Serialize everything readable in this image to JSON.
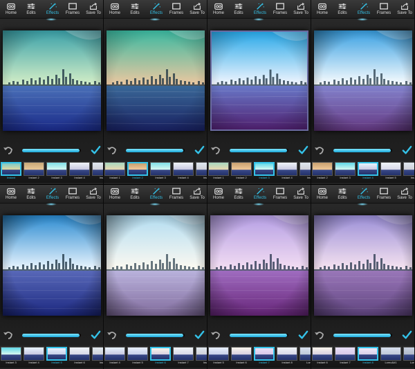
{
  "toolbar": [
    {
      "label": "Home",
      "icon": "home-icon"
    },
    {
      "label": "Edits",
      "icon": "sliders-icon"
    },
    {
      "label": "Effects",
      "icon": "magic-wand-icon"
    },
    {
      "label": "Frames",
      "icon": "frame-icon"
    },
    {
      "label": "Save To",
      "icon": "share-icon"
    }
  ],
  "active_tab": "Effects",
  "accent_color": "#34c2e8",
  "panels": [
    {
      "photo": {
        "sky_top": "#3aa0a8",
        "sky_bottom": "#d8f0c8",
        "water_top": "#4a70b8",
        "water_bottom": "#1a2a88",
        "overlay": "rgba(0,0,0,0)",
        "bordered": false,
        "vignette": 0.4
      },
      "slider_value": 0.98,
      "thumbs": [
        {
          "label": "Instant",
          "colors": [
            "#7dc8c8",
            "#e0d9a0"
          ],
          "selected": true
        },
        {
          "label": "Instant 2",
          "colors": [
            "#c8a878",
            "#e8c898"
          ],
          "selected": false
        },
        {
          "label": "Instant 3",
          "colors": [
            "#80e0e8",
            "#d8f8f0"
          ],
          "selected": false
        },
        {
          "label": "Instant 4",
          "colors": [
            "#f0f4f8",
            "#c8c8e0"
          ],
          "selected": false
        },
        {
          "label": "Insta",
          "colors": [
            "#e0e8f0",
            "#d0d0d8"
          ],
          "selected": false
        }
      ]
    },
    {
      "photo": {
        "sky_top": "#3ab8a0",
        "sky_bottom": "#f0c8a0",
        "water_top": "#3a6898",
        "water_bottom": "#182060",
        "overlay": "rgba(0,0,0,0)",
        "bordered": false,
        "vignette": 0.3
      },
      "slider_value": 0.98,
      "thumbs": [
        {
          "label": "Instant 1",
          "colors": [
            "#a8d8c0",
            "#e8d8b0"
          ],
          "selected": false
        },
        {
          "label": "Instant 2",
          "colors": [
            "#c8a070",
            "#f0c898"
          ],
          "selected": true
        },
        {
          "label": "Instant 3",
          "colors": [
            "#80e0e8",
            "#d8f8f0"
          ],
          "selected": false
        },
        {
          "label": "Instant 4",
          "colors": [
            "#f0f4f8",
            "#c8c8e0"
          ],
          "selected": false
        },
        {
          "label": "Insta",
          "colors": [
            "#e0e8f0",
            "#d0d0d8"
          ],
          "selected": false
        }
      ]
    },
    {
      "photo": {
        "sky_top": "#28a8e8",
        "sky_bottom": "#f8f8ff",
        "water_top": "#6878c8",
        "water_bottom": "#502070",
        "overlay": "rgba(0,0,0,0)",
        "bordered": true,
        "vignette": 0.3
      },
      "slider_value": 0.98,
      "thumbs": [
        {
          "label": "Instant 1",
          "colors": [
            "#a8d8c0",
            "#e8d8b0"
          ],
          "selected": false
        },
        {
          "label": "Instant 2",
          "colors": [
            "#c8a070",
            "#f0c898"
          ],
          "selected": false
        },
        {
          "label": "Instant 3",
          "colors": [
            "#60d8e8",
            "#d8f8f0"
          ],
          "selected": true
        },
        {
          "label": "Instant 4",
          "colors": [
            "#f0f4f8",
            "#c8c8e0"
          ],
          "selected": false
        },
        {
          "label": "Insta",
          "colors": [
            "#e0e8f0",
            "#d0d0d8"
          ],
          "selected": false
        }
      ]
    },
    {
      "photo": {
        "sky_top": "#2898e0",
        "sky_bottom": "#ffffff",
        "water_top": "#7878c8",
        "water_bottom": "#582878",
        "overlay": "rgba(255,255,255,0.08)",
        "bordered": false,
        "vignette": 0.55
      },
      "slider_value": 0.98,
      "thumbs": [
        {
          "label": "Instant 2",
          "colors": [
            "#c8a070",
            "#f0c898"
          ],
          "selected": false
        },
        {
          "label": "Instant 3",
          "colors": [
            "#60d8e8",
            "#d8f8f0"
          ],
          "selected": false
        },
        {
          "label": "Instant 4",
          "colors": [
            "#e8f4ff",
            "#c8c8e0"
          ],
          "selected": true
        },
        {
          "label": "Instant 5",
          "colors": [
            "#f0f4f8",
            "#d8d8e8"
          ],
          "selected": false
        },
        {
          "label": "Insta",
          "colors": [
            "#e0e8f0",
            "#d0d0d8"
          ],
          "selected": false
        }
      ]
    },
    {
      "photo": {
        "sky_top": "#2a8ad0",
        "sky_bottom": "#f0f8ff",
        "water_top": "#5868b8",
        "water_bottom": "#1c2880",
        "overlay": "rgba(0,0,0,0)",
        "bordered": false,
        "vignette": 0.6
      },
      "slider_value": 0.98,
      "thumbs": [
        {
          "label": "Instant 3",
          "colors": [
            "#60d8e8",
            "#d8f8f0"
          ],
          "selected": false
        },
        {
          "label": "Instant 4",
          "colors": [
            "#e8f4ff",
            "#c8c8e0"
          ],
          "selected": false
        },
        {
          "label": "Instant 5",
          "colors": [
            "#e8f0ff",
            "#c8d0e8"
          ],
          "selected": true
        },
        {
          "label": "Instant 6",
          "colors": [
            "#f0f4f8",
            "#d8d8e8"
          ],
          "selected": false
        },
        {
          "label": "Insta",
          "colors": [
            "#e0e8f0",
            "#d0d0d8"
          ],
          "selected": false
        }
      ]
    },
    {
      "photo": {
        "sky_top": "#a8d8f0",
        "sky_bottom": "#fffaf0",
        "water_top": "#b0a8d8",
        "water_bottom": "#705890",
        "overlay": "rgba(255,255,255,0.12)",
        "bordered": false,
        "vignette": 0.6
      },
      "slider_value": 0.98,
      "thumbs": [
        {
          "label": "Instant 4",
          "colors": [
            "#e8f4ff",
            "#c8c8e0"
          ],
          "selected": false
        },
        {
          "label": "Instant 5",
          "colors": [
            "#e8f0ff",
            "#c8d0e8"
          ],
          "selected": false
        },
        {
          "label": "Instant 6",
          "colors": [
            "#f8f4ec",
            "#d8d0e0"
          ],
          "selected": true
        },
        {
          "label": "Instant 7",
          "colors": [
            "#f0f4f8",
            "#d8d8e8"
          ],
          "selected": false
        },
        {
          "label": "Insta",
          "colors": [
            "#e0e8f0",
            "#d0d0d8"
          ],
          "selected": false
        }
      ]
    },
    {
      "photo": {
        "sky_top": "#b8a8e8",
        "sky_bottom": "#fff0f8",
        "water_top": "#a070c0",
        "water_bottom": "#602070",
        "overlay": "rgba(160,80,200,0.1)",
        "bordered": false,
        "vignette": 0.5
      },
      "slider_value": 0.98,
      "thumbs": [
        {
          "label": "Instant 5",
          "colors": [
            "#e8f0ff",
            "#c8d0e8"
          ],
          "selected": false
        },
        {
          "label": "Instant 6",
          "colors": [
            "#f8f4ec",
            "#d8d0e0"
          ],
          "selected": false
        },
        {
          "label": "Instant 7",
          "colors": [
            "#e8e0f8",
            "#d8c8e8"
          ],
          "selected": true
        },
        {
          "label": "Instant 8",
          "colors": [
            "#f0f4f8",
            "#d8d8e8"
          ],
          "selected": false
        },
        {
          "label": "Lomo",
          "colors": [
            "#d8e0f0",
            "#c0c8d8"
          ],
          "selected": false
        }
      ]
    },
    {
      "photo": {
        "sky_top": "#9890d8",
        "sky_bottom": "#fff0f4",
        "water_top": "#9878b8",
        "water_bottom": "#584078",
        "overlay": "rgba(180,120,200,0.08)",
        "bordered": false,
        "vignette": 0.55
      },
      "slider_value": 0.98,
      "thumbs": [
        {
          "label": "Instant 6",
          "colors": [
            "#f8f4ec",
            "#d8d0e0"
          ],
          "selected": false
        },
        {
          "label": "Instant 7",
          "colors": [
            "#e8e0f8",
            "#d8c8e8"
          ],
          "selected": false
        },
        {
          "label": "Instant 8",
          "colors": [
            "#f0e8f8",
            "#d8d0e8"
          ],
          "selected": true
        },
        {
          "label": "Lomo&#1",
          "colors": [
            "#d8e0f0",
            "#c0c8d8"
          ],
          "selected": false
        },
        {
          "label": "Lomo",
          "colors": [
            "#c8d0e0",
            "#b0b8c8"
          ],
          "selected": false
        }
      ]
    }
  ]
}
